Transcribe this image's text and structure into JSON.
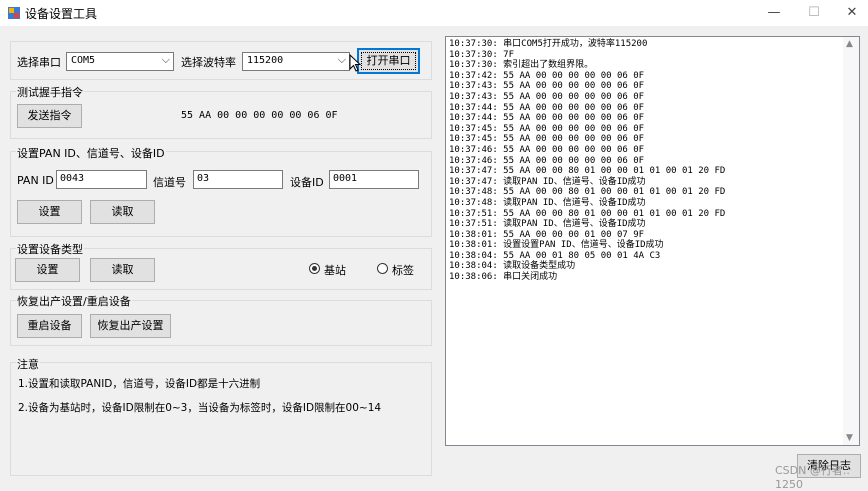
{
  "window": {
    "title": "设备设置工具",
    "minimize": "—",
    "maximize": "☐",
    "close": "✕"
  },
  "serial": {
    "port_label": "选择串口",
    "port_value": "COM5",
    "baud_label": "选择波特率",
    "baud_value": "115200",
    "open_button": "打开串口"
  },
  "handshake": {
    "group_label": "测试握手指令",
    "send_button": "发送指令",
    "command_text": "55 AA 00 00 00 00 00 06 0F"
  },
  "pan": {
    "group_label": "设置PAN ID、信道号、设备ID",
    "pan_label": "PAN ID",
    "pan_value": "0043",
    "channel_label": "信道号",
    "channel_value": "03",
    "device_label": "设备ID",
    "device_value": "0001",
    "set_button": "设置",
    "read_button": "读取"
  },
  "devtype": {
    "group_label": "设置设备类型",
    "set_button": "设置",
    "read_button": "读取",
    "radio_base": "基站",
    "radio_tag": "标签",
    "selected": "基站"
  },
  "reset": {
    "group_label": "恢复出产设置/重启设备",
    "restart_button": "重启设备",
    "factory_button": "恢复出产设置"
  },
  "notes": {
    "group_label": "注意",
    "line1": "1.设置和读取PANID，信道号，设备ID都是十六进制",
    "line2": "2.设备为基站时，设备ID限制在0~3，当设备为标签时，设备ID限制在00~14"
  },
  "log": {
    "lines": [
      "10:37:30: 串口COM5打开成功，波特率115200",
      "10:37:30: 7F",
      "10:37:30: 索引超出了数组界限。",
      "10:37:42: 55 AA 00 00 00 00 00 06 0F",
      "10:37:43: 55 AA 00 00 00 00 00 06 0F",
      "10:37:43: 55 AA 00 00 00 00 00 06 0F",
      "10:37:44: 55 AA 00 00 00 00 00 06 0F",
      "10:37:44: 55 AA 00 00 00 00 00 06 0F",
      "10:37:45: 55 AA 00 00 00 00 00 06 0F",
      "10:37:45: 55 AA 00 00 00 00 00 06 0F",
      "10:37:46: 55 AA 00 00 00 00 00 06 0F",
      "10:37:46: 55 AA 00 00 00 00 00 06 0F",
      "10:37:47: 55 AA 00 00 80 01 00 00 01 01 00 01 20 FD",
      "10:37:47: 读取PAN ID、信道号、设备ID成功",
      "10:37:48: 55 AA 00 00 80 01 00 00 01 01 00 01 20 FD",
      "10:37:48: 读取PAN ID、信道号、设备ID成功",
      "10:37:51: 55 AA 00 00 80 01 00 00 01 01 00 01 20 FD",
      "10:37:51: 读取PAN ID、信道号、设备ID成功",
      "10:38:01: 55 AA 00 00 00 01 00 07 9F",
      "10:38:01: 设置设置PAN ID、信道号、设备ID成功",
      "10:38:04: 55 AA 00 01 80 05 00 01 4A C3",
      "10:38:04: 读取设备类型成功",
      "10:38:06: 串口关闭成功"
    ],
    "clear_button": "清除日志"
  },
  "watermark": "CSDN @行者.. 1250"
}
